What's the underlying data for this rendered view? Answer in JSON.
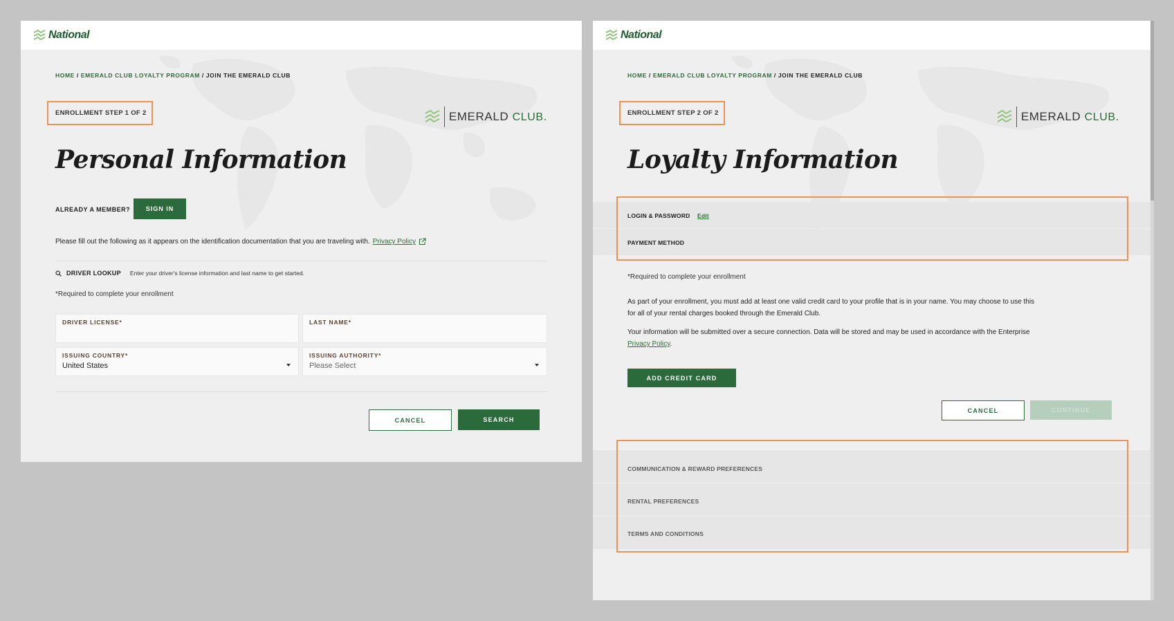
{
  "brand": {
    "name": "National",
    "program_logo_main": "EMERALD",
    "program_logo_club": "CLUB",
    "program_logo_dot": "."
  },
  "breadcrumb": {
    "home": "HOME",
    "sep1": "/",
    "program": "EMERALD CLUB LOYALTY PROGRAM",
    "sep2": "/",
    "current": "JOIN THE EMERALD CLUB"
  },
  "step1": {
    "step_label": "ENROLLMENT STEP 1 OF 2",
    "title": "Personal Information",
    "already_member_label": "ALREADY A MEMBER?",
    "sign_in_label": "SIGN IN",
    "instructions": "Please fill out the following as it appears on the identification documentation that you are traveling with.",
    "privacy_link": "Privacy Policy",
    "lookup_title": "DRIVER LOOKUP",
    "lookup_description": "Enter your driver's license information and last name to get started.",
    "required_note": "*Required to complete your enrollment",
    "fields": {
      "driver_license": {
        "label": "DRIVER LICENSE*",
        "value": ""
      },
      "last_name": {
        "label": "LAST NAME*",
        "value": ""
      },
      "issuing_country": {
        "label": "ISSUING COUNTRY*",
        "value": "United States"
      },
      "issuing_authority": {
        "label": "ISSUING AUTHORITY*",
        "placeholder": "Please Select"
      }
    },
    "cancel_label": "CANCEL",
    "search_label": "SEARCH"
  },
  "step2": {
    "step_label": "ENROLLMENT STEP 2 OF 2",
    "title": "Loyalty Information",
    "sections": {
      "login_password": "LOGIN & PASSWORD",
      "login_edit": "Edit",
      "payment_method": "PAYMENT METHOD",
      "communication": "COMMUNICATION & REWARD PREFERENCES",
      "rental": "RENTAL PREFERENCES",
      "terms": "TERMS AND CONDITIONS"
    },
    "required_note": "*Required to complete your enrollment",
    "para1": "As part of your enrollment, you must add at least one valid credit card to your profile that is in your name. You may choose to use this for all of your rental charges booked through the Emerald Club.",
    "para2_prefix": "Your information will be submitted over a secure connection. Data will be stored and may be used in accordance with the Enterprise",
    "privacy_link": "Privacy Policy",
    "para2_suffix": ".",
    "add_card_label": "ADD CREDIT CARD",
    "cancel_label": "CANCEL",
    "continue_label": "CONTINUE"
  },
  "colors": {
    "brand_green": "#2b6a3a",
    "highlight_orange": "#f0924f",
    "light_green": "#8fc47a"
  }
}
